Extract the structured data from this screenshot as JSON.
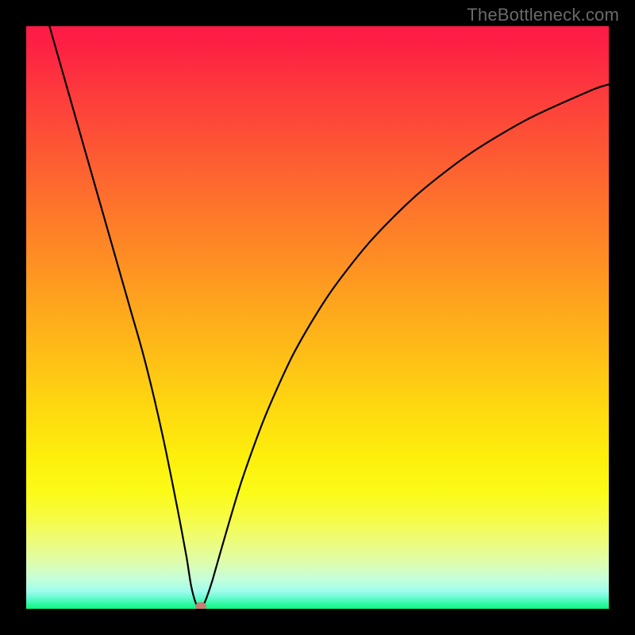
{
  "watermark": "TheBottleneck.com",
  "chart_data": {
    "type": "line",
    "title": "",
    "xlabel": "",
    "ylabel": "",
    "xlim": [
      0,
      100
    ],
    "ylim": [
      0,
      100
    ],
    "grid": false,
    "legend": false,
    "background": "rainbow-vertical-gradient",
    "series": [
      {
        "name": "bottleneck-curve",
        "color": "#000000",
        "x": [
          4,
          6,
          8,
          10,
          12,
          14,
          16,
          18,
          20,
          22,
          24,
          26,
          27.5,
          28.3,
          29.1,
          29.7,
          30.0,
          30.3,
          31,
          32,
          34,
          37,
          41,
          46,
          52,
          59,
          67,
          76,
          86,
          97,
          100
        ],
        "values": [
          100,
          93,
          86,
          79,
          72,
          65,
          58,
          51,
          44,
          36,
          27,
          17,
          9,
          4,
          1,
          0.2,
          0.0,
          0.4,
          2,
          5,
          12,
          22,
          33,
          44,
          54,
          63,
          71,
          78,
          84,
          89,
          90
        ]
      }
    ],
    "marker": {
      "x": 30.0,
      "y": 0.4,
      "color": "#c67e72"
    }
  }
}
